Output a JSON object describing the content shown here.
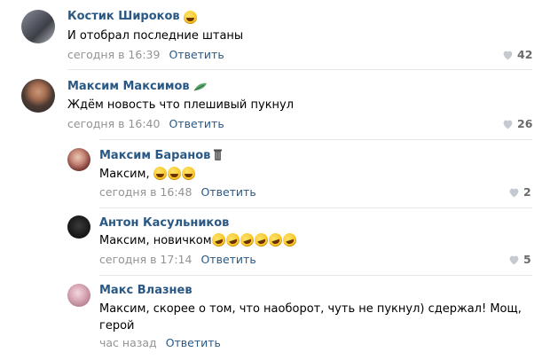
{
  "colors": {
    "author": "#2a5885",
    "meta": "#939393",
    "link": "#2a5885",
    "likes": "#6a6a6a",
    "divider": "#e7e8ec"
  },
  "comments": [
    {
      "author": "Костик Широков",
      "badge_icon": "grinning-tongue-emoji-icon",
      "text": "И отобрал последние штаны",
      "time": "сегодня в 16:39",
      "reply": "Ответить",
      "likes": "42"
    },
    {
      "author": "Максим Максимов",
      "badge_icon": "leaf-sticker-icon",
      "text": "Ждём новость что плешивый пукнул",
      "time": "сегодня в 16:40",
      "reply": "Ответить",
      "likes": "26"
    },
    {
      "author": "Максим Баранов",
      "badge_icon": "trash-can-sticker-icon",
      "text": "Максим,",
      "emoji_icons": [
        "tears-of-joy-emoji-icon",
        "tears-of-joy-emoji-icon",
        "tears-of-joy-emoji-icon"
      ],
      "time": "сегодня в 16:48",
      "reply": "Ответить",
      "likes": "2"
    },
    {
      "author": "Антон Касульников",
      "text": "Максим, новичком",
      "emoji_icons": [
        "rofl-emoji-icon",
        "rofl-emoji-icon",
        "rofl-emoji-icon",
        "rofl-emoji-icon",
        "rofl-emoji-icon",
        "rofl-emoji-icon"
      ],
      "time": "сегодня в 17:14",
      "reply": "Ответить",
      "likes": "5"
    },
    {
      "author": "Макс Влазнев",
      "text": "Максим, скорее о том, что наоборот, чуть не пукнул) сдержал! Мощ, герой",
      "time": "час назад",
      "reply": "Ответить"
    }
  ]
}
